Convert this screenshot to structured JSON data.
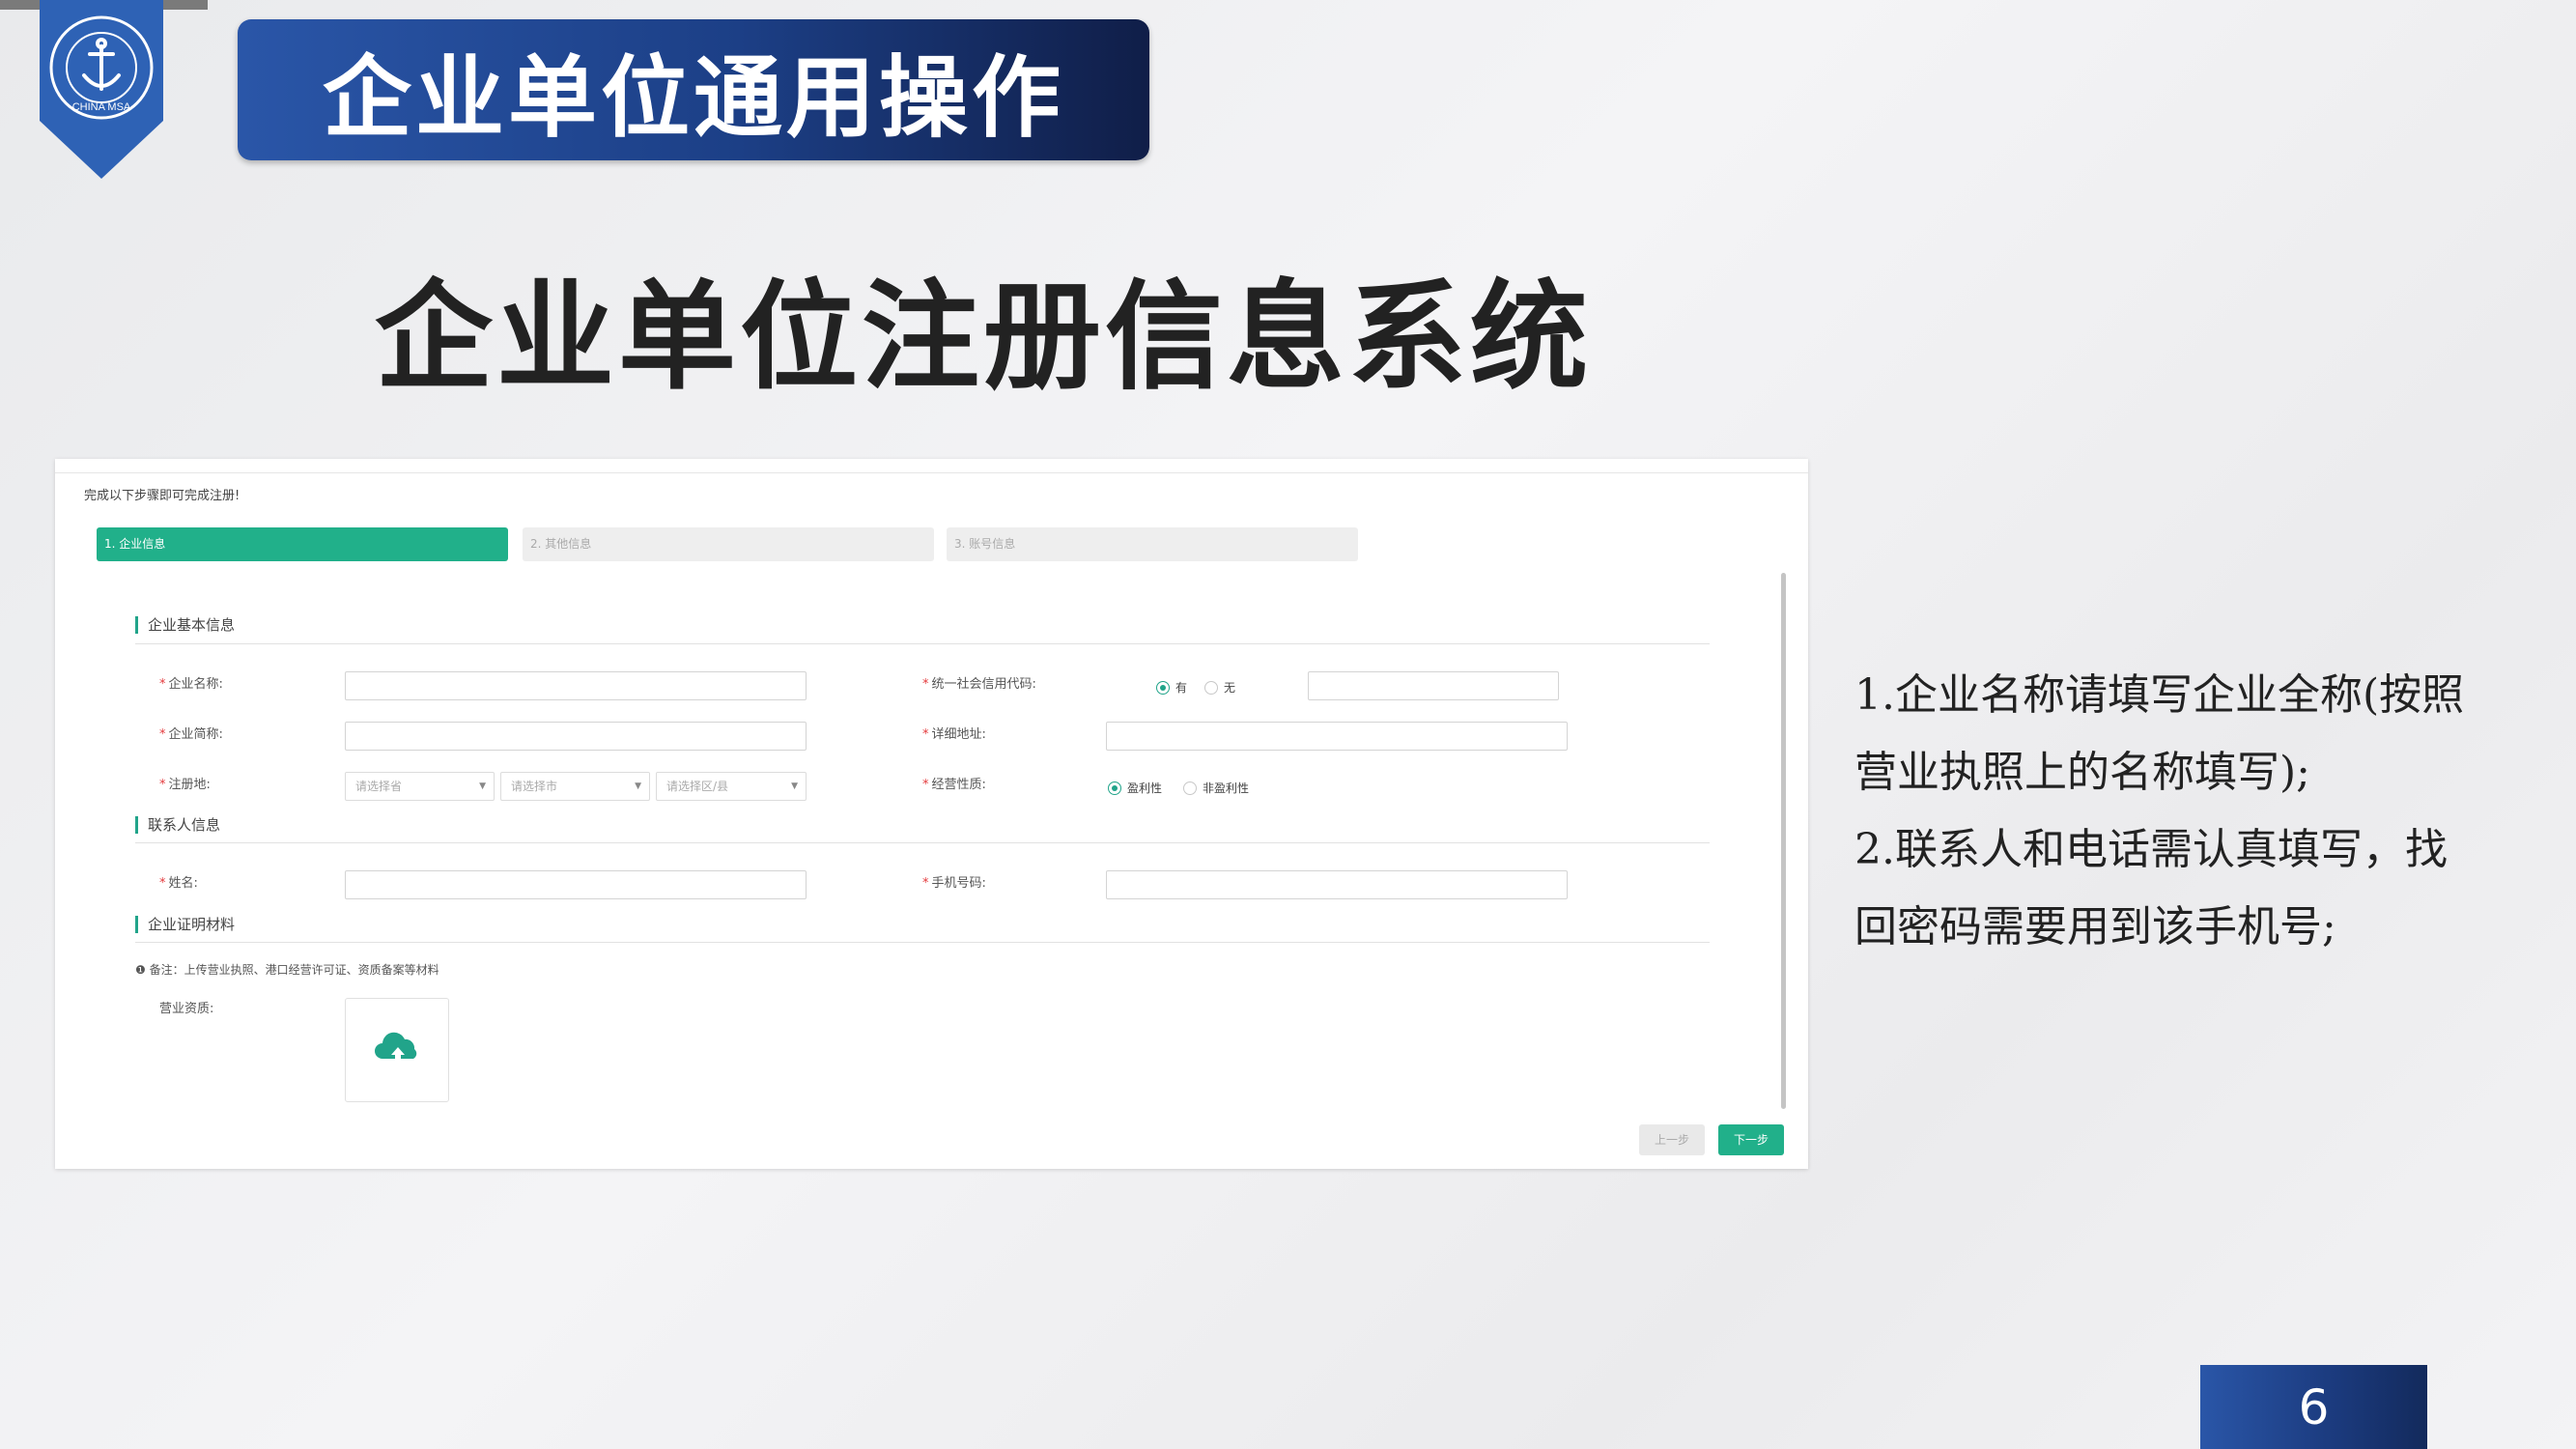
{
  "header": {
    "title": "企业单位通用操作"
  },
  "badge": {
    "text": "CHINA MSA"
  },
  "main_title": "企业单位注册信息系统",
  "form": {
    "intro": "完成以下步骤即可完成注册!",
    "steps": [
      {
        "label": "1. 企业信息",
        "active": true
      },
      {
        "label": "2. 其他信息",
        "active": false
      },
      {
        "label": "3. 账号信息",
        "active": false
      }
    ],
    "sections": {
      "basic": "企业基本信息",
      "contact": "联系人信息",
      "cert": "企业证明材料"
    },
    "fields": {
      "company_name": "企业名称:",
      "credit_code": "统一社会信用代码:",
      "has": "有",
      "none": "无",
      "short_name": "企业简称:",
      "address": "详细地址:",
      "reg_place": "注册地:",
      "province": "请选择省",
      "city": "请选择市",
      "district": "请选择区/县",
      "nature": "经营性质:",
      "profit": "盈利性",
      "nonprofit": "非盈利性",
      "name": "姓名:",
      "phone": "手机号码:",
      "license": "营业资质:"
    },
    "note": "备注：上传营业执照、港口经营许可证、资质备案等材料",
    "buttons": {
      "prev": "上一步",
      "next": "下一步"
    }
  },
  "side_notes": [
    "1.企业名称请填写企业全称(按照营业执照上的名称填写);",
    "2.联系人和电话需认真填写，找回密码需要用到该手机号;"
  ],
  "page_number": "6",
  "colors": {
    "accent": "#21b08a",
    "navy": "#1c3f86"
  }
}
